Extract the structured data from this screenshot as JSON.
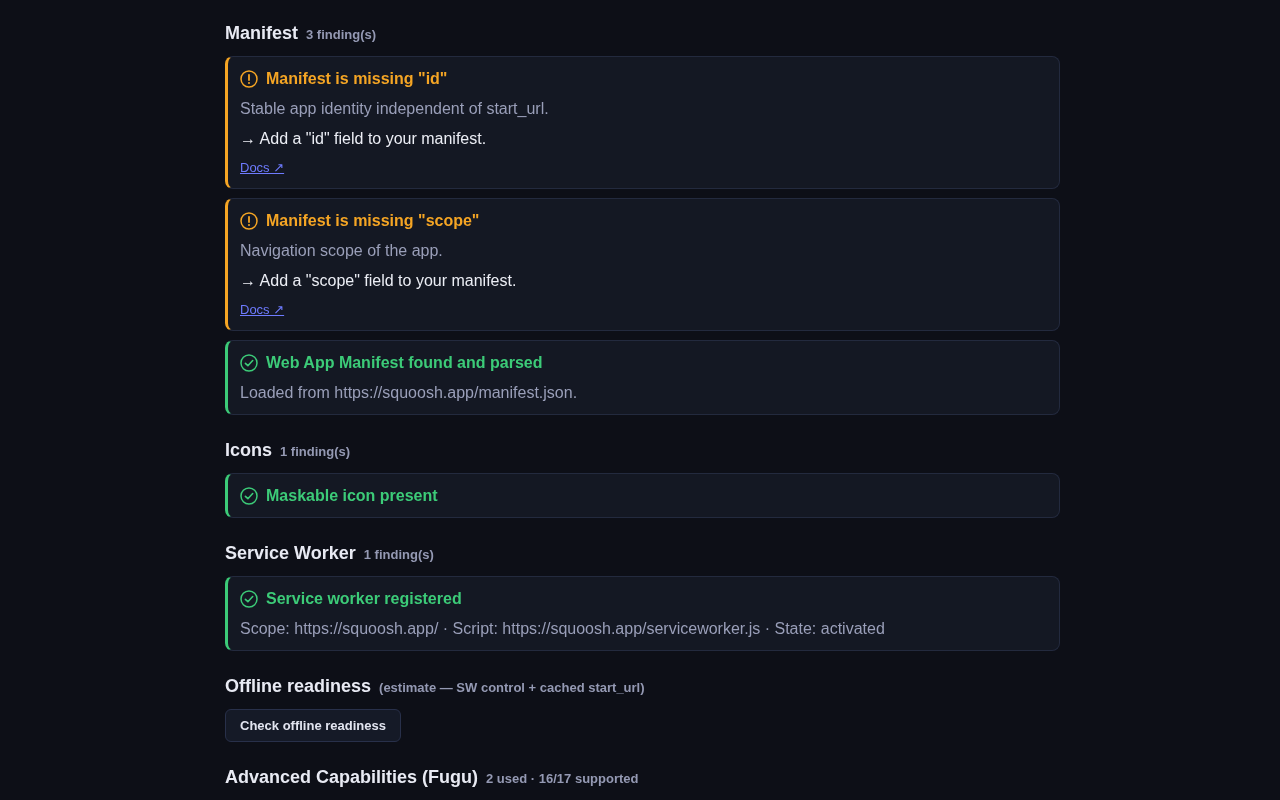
{
  "sections": [
    {
      "title": "Manifest",
      "meta": "3 finding(s)",
      "findings": [
        {
          "kind": "warning",
          "title": "Manifest is missing \"id\"",
          "description": "Stable app identity independent of start_url.",
          "fix": "→ Add a \"id\" field to your manifest.",
          "link": "Docs ↗"
        },
        {
          "kind": "warning",
          "title": "Manifest is missing \"scope\"",
          "description": "Navigation scope of the app.",
          "fix": "→ Add a \"scope\" field to your manifest.",
          "link": "Docs ↗"
        },
        {
          "kind": "pass",
          "title": "Web App Manifest found and parsed",
          "description": "Loaded from https://squoosh.app/manifest.json."
        }
      ]
    },
    {
      "title": "Icons",
      "meta": "1 finding(s)",
      "findings": [
        {
          "kind": "pass",
          "title": "Maskable icon present"
        }
      ]
    },
    {
      "title": "Service Worker",
      "meta": "1 finding(s)",
      "findings": [
        {
          "kind": "pass",
          "title": "Service worker registered",
          "description": "Scope: https://squoosh.app/ · Script: https://squoosh.app/serviceworker.js · State: activated"
        }
      ]
    },
    {
      "title": "Offline readiness",
      "meta": "(estimate — SW control + cached start_url)",
      "button": "Check offline readiness"
    },
    {
      "title": "Advanced Capabilities (Fugu)",
      "meta": "2 used · 16/17 supported"
    }
  ]
}
